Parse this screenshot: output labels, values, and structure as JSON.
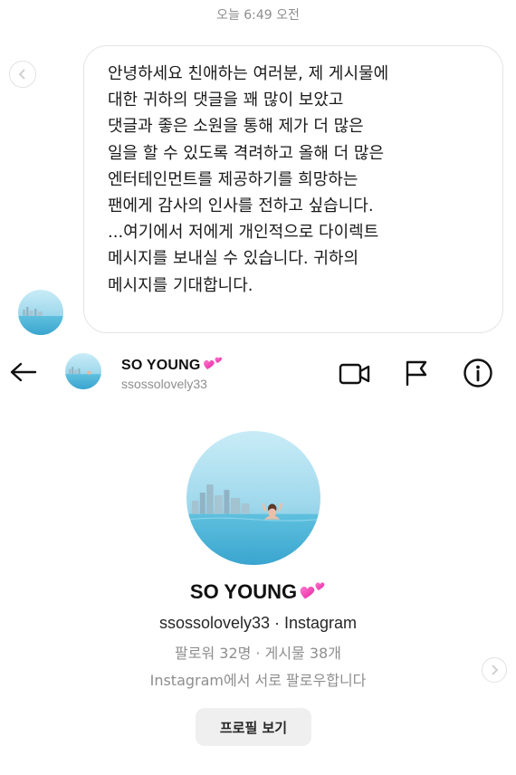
{
  "timestamp": "오늘 6:49 오전",
  "message": {
    "lines": [
      "안녕하세요 친애하는 여러분, 제 게시물에",
      "대한 귀하의 댓글을 꽤 많이 보았고",
      "댓글과 좋은 소원을 통해 제가 더 많은",
      "일을 할 수 있도록 격려하고 올해 더 많은",
      "엔터테인먼트를 제공하기를 희망하는",
      "팬에게 감사의 인사를 전하고 싶습니다.",
      "...여기에서 저에게 개인적으로 다이렉트",
      "메시지를 보내실 수 있습니다. 귀하의",
      "메시지를 기대합니다."
    ]
  },
  "header": {
    "name": "SO YOUNG",
    "username": "ssossolovely33",
    "icons": [
      "back-arrow-icon",
      "video-call-icon",
      "flag-icon",
      "info-icon"
    ]
  },
  "profile": {
    "name": "SO YOUNG",
    "subtitle": "ssossolovely33 · Instagram",
    "stats": "팔로워 32명 · 게시물 38개",
    "mutual": "Instagram에서 서로 팔로우합니다",
    "view_profile_button": "프로필 보기"
  },
  "colors": {
    "heart": "#ff4fbd",
    "secondary_text": "#8e8e8e",
    "button_bg": "#efefef"
  }
}
